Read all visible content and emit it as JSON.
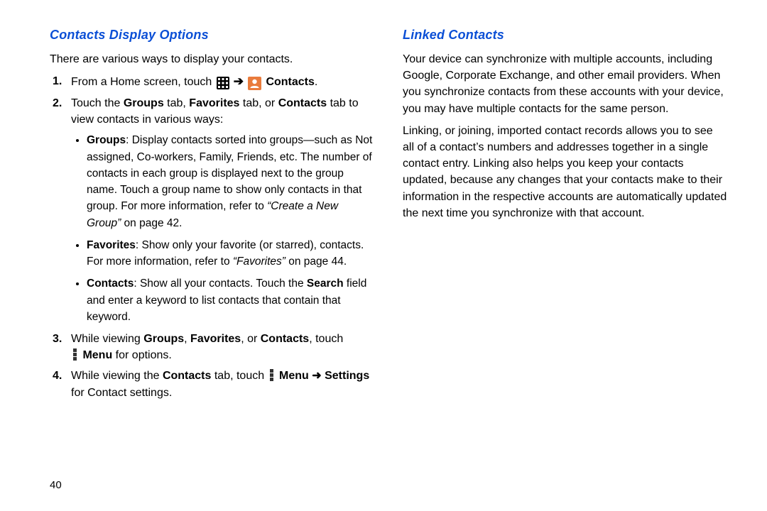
{
  "page_number": "40",
  "left": {
    "heading": "Contacts Display Options",
    "intro": "There are various ways to display your contacts.",
    "step1_a": "From a Home screen, touch ",
    "step1_b": "Contacts",
    "step1_c": ".",
    "step2_a": "Touch the ",
    "step2_b": "Groups",
    "step2_c": " tab, ",
    "step2_d": "Favorites",
    "step2_e": " tab, or ",
    "step2_f": "Contacts",
    "step2_g": " tab to view contacts in various ways:",
    "b1_a": "Groups",
    "b1_b": ": Display contacts sorted into groups—such as Not assigned, Co-workers, Family, Friends, etc. The number of contacts in each group is displayed next to the group name. Touch a group name to show only contacts in that group. For more information, refer to ",
    "b1_c": "“Create a New Group”",
    "b1_d": " on page 42.",
    "b2_a": "Favorites",
    "b2_b": ": Show only your favorite (or starred), contacts. For more information, refer to ",
    "b2_c": "“Favorites”",
    "b2_d": " on page 44.",
    "b3_a": "Contacts",
    "b3_b": ": Show all your contacts. Touch the ",
    "b3_c": "Search",
    "b3_d": " field and enter a keyword to list contacts that contain that keyword.",
    "step3_a": "While viewing ",
    "step3_b": "Groups",
    "step3_c": ", ",
    "step3_d": "Favorites",
    "step3_e": ", or ",
    "step3_f": "Contacts",
    "step3_g": ", touch ",
    "step3_h": "Menu",
    "step3_i": " for options.",
    "step4_a": "While viewing the ",
    "step4_b": "Contacts",
    "step4_c": " tab, touch ",
    "step4_d": "Menu",
    "step4_e": " ➜ ",
    "step4_f": "Settings",
    "step4_g": " for Contact settings."
  },
  "right": {
    "heading": "Linked Contacts",
    "p1": "Your device can synchronize with multiple accounts, including Google, Corporate Exchange, and other email providers. When you synchronize contacts from these accounts with your device, you may have multiple contacts for the same person.",
    "p2": "Linking, or joining, imported contact records allows you to see all of a contact’s numbers and addresses together in a single contact entry. Linking also helps you keep your contacts updated, because any changes that your contacts make to their information in the respective accounts are automatically updated the next time you synchronize with that account."
  }
}
